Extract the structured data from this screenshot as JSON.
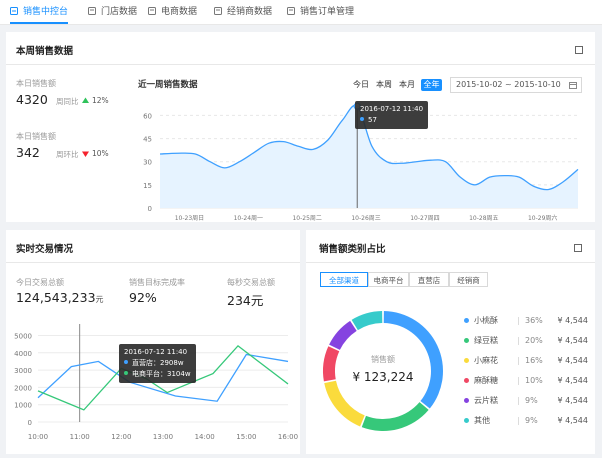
{
  "tabs": [
    {
      "label": "销售中控台",
      "icon": "dashboard-icon"
    },
    {
      "label": "门店数据",
      "icon": "store-icon"
    },
    {
      "label": "电商数据",
      "icon": "ecommerce-icon"
    },
    {
      "label": "经销商数据",
      "icon": "dealer-icon"
    },
    {
      "label": "销售订单管理",
      "icon": "order-icon"
    }
  ],
  "colors": {
    "accent": "#1890ff",
    "up": "#2fc25b",
    "down": "#f5222d",
    "line2": "#2fc25b"
  },
  "weekly": {
    "title": "本周销售数据",
    "today_sales_label": "本日销售额",
    "today_sales_value": "4320",
    "yoy_label": "周同比",
    "yoy_value": "12%",
    "yoy_trend": "up",
    "yesterday_label": "本日销售额",
    "yesterday_value": "342",
    "mom_label": "周环比",
    "mom_value": "10%",
    "mom_trend": "down",
    "chart_title": "近一周销售数据",
    "ranges": [
      "今日",
      "本周",
      "本月",
      "全年"
    ],
    "active_range": "全年",
    "date_range": "2015-10-02 ~ 2015-10-10",
    "tooltip": {
      "time": "2016-07-12  11:40",
      "value": "57"
    }
  },
  "realtime": {
    "title": "实时交易情况",
    "stats": [
      {
        "label": "今日交易总额",
        "value": "124,543,233",
        "unit": "元"
      },
      {
        "label": "销售目标完成率",
        "value": "92%",
        "unit": ""
      },
      {
        "label": "每秒交易总额",
        "value": "234元",
        "unit": ""
      }
    ],
    "tooltip": {
      "time": "2016-07-12  11:40",
      "line1": "直营店：2908w",
      "line2": "电商平台：3104w"
    }
  },
  "category": {
    "title": "销售额类别占比",
    "filters": [
      "全部渠道",
      "电商平台",
      "直营店",
      "经销商"
    ],
    "active_filter": "全部渠道",
    "center_label": "销售额",
    "center_value": "¥ 123,224",
    "items": [
      {
        "name": "小桃酥",
        "percent": "36%",
        "amount": "¥ 4,544",
        "color": "#3fa0ff"
      },
      {
        "name": "绿豆糕",
        "percent": "20%",
        "amount": "¥ 4,544",
        "color": "#36c87a"
      },
      {
        "name": "小麻花",
        "percent": "16%",
        "amount": "¥ 4,544",
        "color": "#fadb3c"
      },
      {
        "name": "麻酥糖",
        "percent": "10%",
        "amount": "¥ 4,544",
        "color": "#f04864"
      },
      {
        "name": "云片糕",
        "percent": "9%",
        "amount": "¥ 4,544",
        "color": "#8543e0"
      },
      {
        "name": "其他",
        "percent": "9%",
        "amount": "¥ 4,544",
        "color": "#36cbcb"
      }
    ]
  },
  "chart_data": [
    {
      "type": "area",
      "title": "近一周销售数据",
      "categories": [
        "10-23周日",
        "10-24周一",
        "10-25周二",
        "10-26周三",
        "10-27周四",
        "10-28周五",
        "10-29周六"
      ],
      "y_ticks": [
        0,
        15,
        30,
        45,
        60
      ],
      "ylim": [
        0,
        70
      ],
      "x": [
        0,
        0.3,
        0.6,
        0.85,
        1.1,
        1.35,
        1.6,
        1.85,
        2.1,
        2.35,
        2.6,
        2.85,
        3.1,
        3.35,
        3.6,
        3.85,
        4.1,
        4.35,
        4.6,
        4.85,
        5.1,
        5.35,
        5.6,
        5.85,
        6.1,
        6.35,
        6.6,
        6.85,
        7.1
      ],
      "values": [
        35,
        35.5,
        35,
        30,
        26,
        30,
        36,
        42,
        43,
        40,
        38,
        44,
        57,
        66,
        40,
        30,
        29,
        30,
        31,
        30,
        20,
        15,
        20,
        21,
        20,
        14,
        12,
        17,
        25
      ],
      "highlight": {
        "x": 3.35,
        "y": 57,
        "label": "2016-07-12 11:40"
      },
      "grid": true
    },
    {
      "type": "line",
      "x": [
        "10:00",
        "11:00",
        "12:00",
        "13:00",
        "14:00",
        "15:00",
        "16:00"
      ],
      "y_ticks": [
        0,
        1000,
        2000,
        3000,
        4000,
        5000
      ],
      "ylim": [
        0,
        5200
      ],
      "series": [
        {
          "name": "直营店",
          "color": "#3fa0ff",
          "points": [
            [
              0,
              1400
            ],
            [
              0.8,
              3200
            ],
            [
              1.45,
              3500
            ],
            [
              2.2,
              2300
            ],
            [
              3.3,
              1500
            ],
            [
              4.3,
              1200
            ],
            [
              5.0,
              3900
            ],
            [
              6.0,
              3500
            ]
          ]
        },
        {
          "name": "电商平台",
          "color": "#36c87a",
          "points": [
            [
              0,
              1800
            ],
            [
              0.6,
              1200
            ],
            [
              1.1,
              700
            ],
            [
              2.0,
              3100
            ],
            [
              2.6,
              2500
            ],
            [
              3.1,
              1700
            ],
            [
              4.2,
              2800
            ],
            [
              4.8,
              4400
            ],
            [
              6.0,
              2200
            ]
          ]
        }
      ],
      "highlight_x": 1.0,
      "grid": true
    },
    {
      "type": "pie",
      "title": "销售额类别占比",
      "labels": [
        "小桃酥",
        "绿豆糕",
        "小麻花",
        "麻酥糖",
        "云片糕",
        "其他"
      ],
      "values": [
        36,
        20,
        16,
        10,
        9,
        9
      ],
      "colors": [
        "#3fa0ff",
        "#36c87a",
        "#fadb3c",
        "#f04864",
        "#8543e0",
        "#36cbcb"
      ],
      "center_label": "销售额",
      "center_value": "¥ 123,224"
    }
  ]
}
